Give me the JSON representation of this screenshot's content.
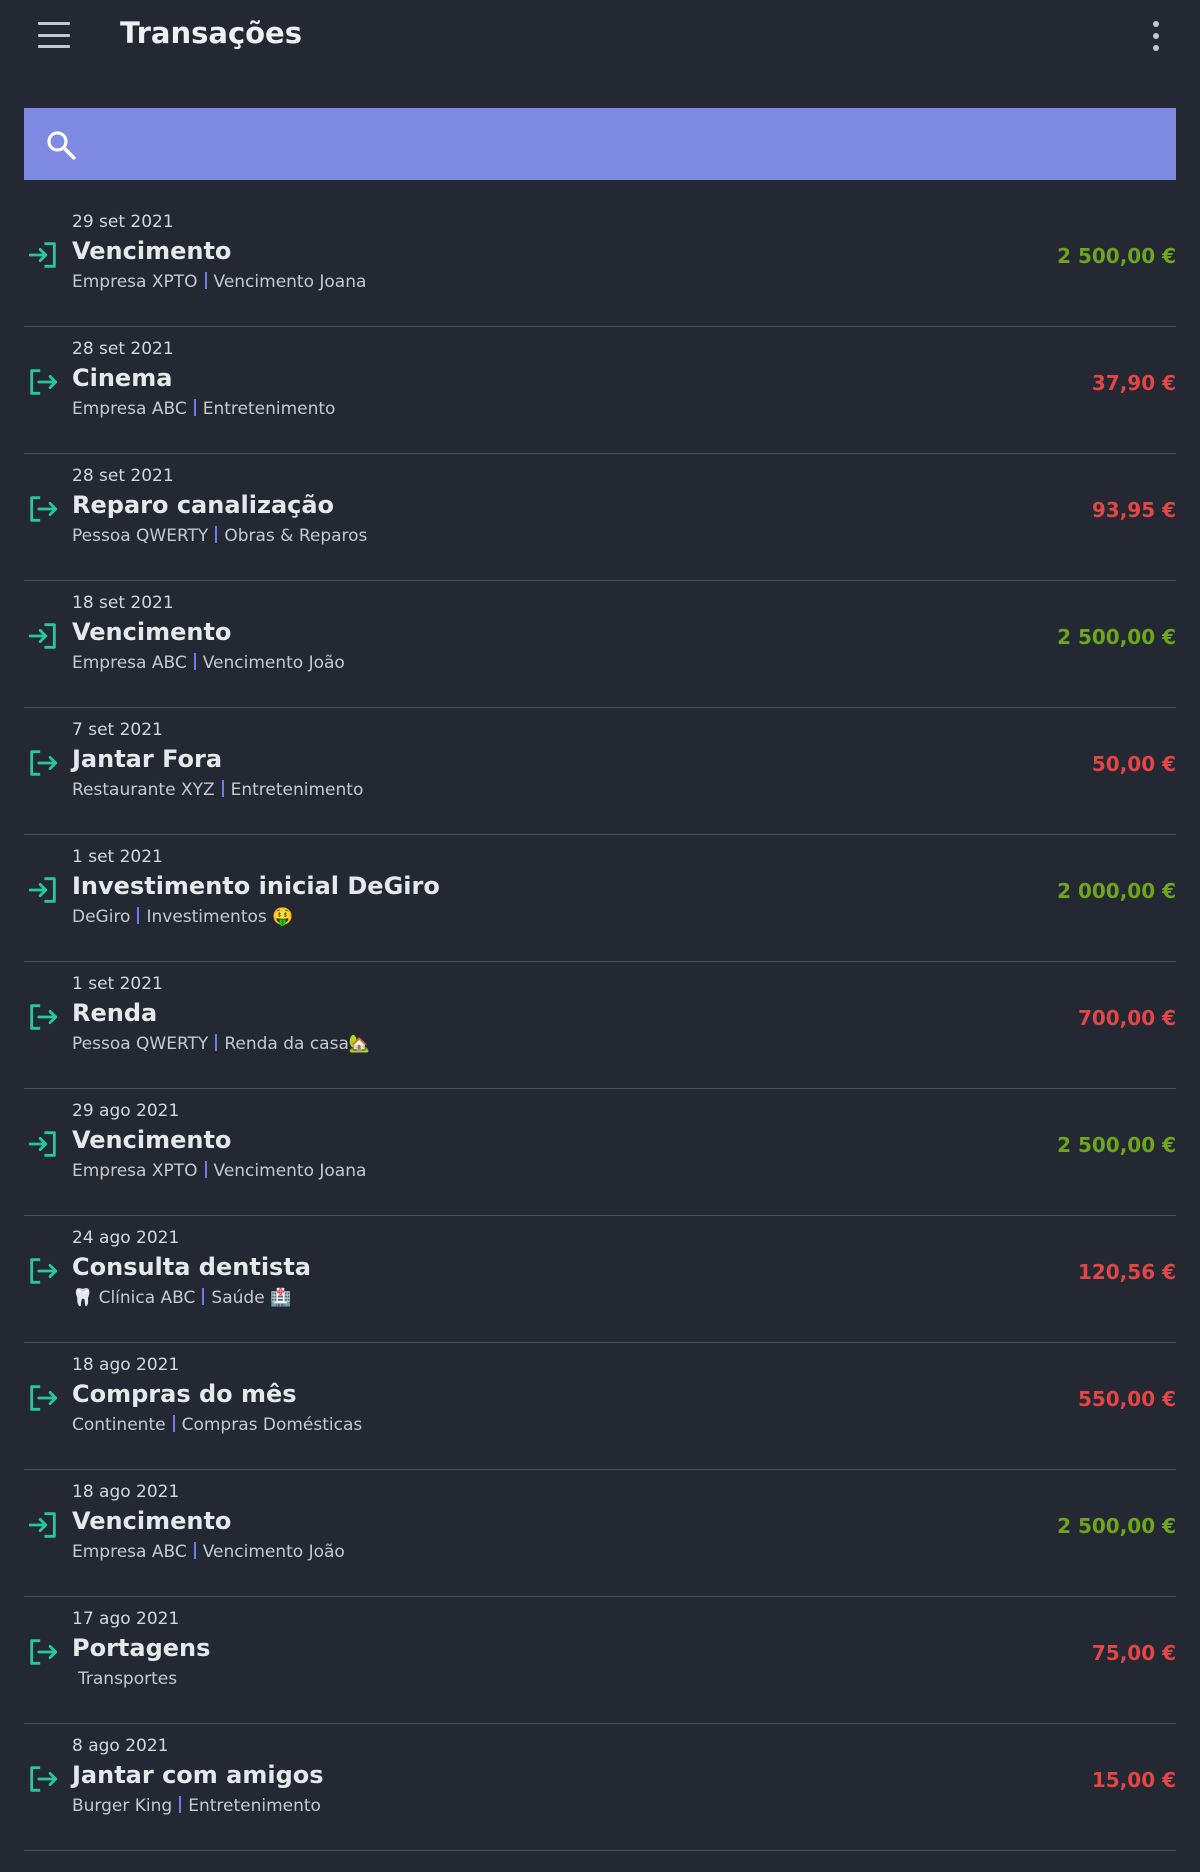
{
  "header": {
    "title": "Transações",
    "menu_icon": "hamburger-menu-icon",
    "more_icon": "more-vertical-icon"
  },
  "search": {
    "placeholder": "",
    "value": "",
    "icon": "search-icon",
    "background_color": "#7f8be2"
  },
  "colors": {
    "background": "#232832",
    "income": "#6ea51e",
    "expense": "#e24646",
    "icon": "#27c8a0",
    "separator": "#6f7bf0"
  },
  "transactions": [
    {
      "date": "29 set 2021",
      "name": "Vencimento",
      "entity": "Empresa XPTO",
      "category": "Vencimento Joana",
      "amount": "2 500,00 €",
      "type": "income"
    },
    {
      "date": "28 set 2021",
      "name": "Cinema",
      "entity": "Empresa ABC",
      "category": "Entretenimento",
      "amount": "37,90 €",
      "type": "expense"
    },
    {
      "date": "28 set 2021",
      "name": "Reparo canalização",
      "entity": "Pessoa QWERTY",
      "category": "Obras & Reparos",
      "amount": "93,95 €",
      "type": "expense"
    },
    {
      "date": "18 set 2021",
      "name": "Vencimento",
      "entity": "Empresa ABC",
      "category": "Vencimento João",
      "amount": "2 500,00 €",
      "type": "income"
    },
    {
      "date": "7 set 2021",
      "name": "Jantar Fora",
      "entity": "Restaurante XYZ",
      "category": "Entretenimento",
      "amount": "50,00 €",
      "type": "expense"
    },
    {
      "date": "1 set 2021",
      "name": "Investimento inicial DeGiro",
      "entity": "DeGiro",
      "category": "Investimentos 🤑",
      "amount": "2 000,00 €",
      "type": "income"
    },
    {
      "date": "1 set 2021",
      "name": "Renda",
      "entity": "Pessoa QWERTY",
      "category": "Renda da casa🏡",
      "amount": "700,00 €",
      "type": "expense"
    },
    {
      "date": "29 ago 2021",
      "name": "Vencimento",
      "entity": "Empresa XPTO",
      "category": "Vencimento Joana",
      "amount": "2 500,00 €",
      "type": "income"
    },
    {
      "date": "24 ago 2021",
      "name": "Consulta dentista",
      "entity": "🦷 Clínica ABC",
      "category": "Saúde 🏥",
      "amount": "120,56 €",
      "type": "expense"
    },
    {
      "date": "18 ago 2021",
      "name": "Compras do mês",
      "entity": "Continente",
      "category": "Compras Domésticas",
      "amount": "550,00 €",
      "type": "expense"
    },
    {
      "date": "18 ago 2021",
      "name": "Vencimento",
      "entity": "Empresa ABC",
      "category": "Vencimento João",
      "amount": "2 500,00 €",
      "type": "income"
    },
    {
      "date": "17 ago 2021",
      "name": "Portagens",
      "entity": "",
      "category": "Transportes",
      "amount": "75,00 €",
      "type": "expense"
    },
    {
      "date": "8 ago 2021",
      "name": "Jantar com amigos",
      "entity": "Burger King",
      "category": "Entretenimento",
      "amount": "15,00 €",
      "type": "expense"
    }
  ]
}
